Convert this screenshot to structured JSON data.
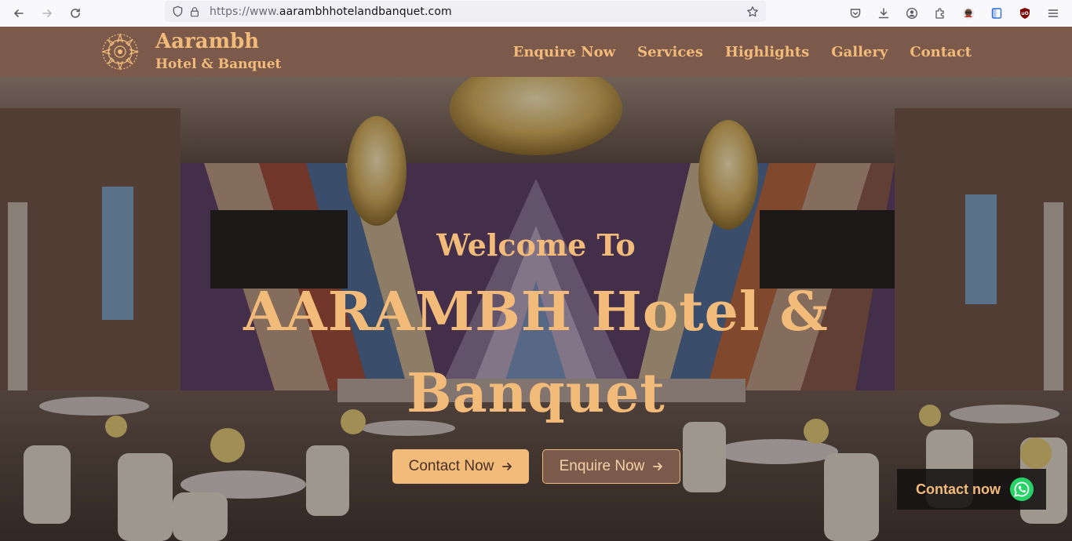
{
  "browser": {
    "url_protocol": "https://www.",
    "url_domain": "aarambhhotelandbanquet.com"
  },
  "header": {
    "brand_name": "Aarambh",
    "brand_sub": "Hotel & Banquet",
    "nav": [
      "Enquire Now",
      "Services",
      "Highlights",
      "Gallery",
      "Contact"
    ]
  },
  "hero": {
    "welcome": "Welcome To",
    "title": "AARAMBH Hotel & Banquet",
    "cta_contact": "Contact Now",
    "cta_enquire": "Enquire Now"
  },
  "floating": {
    "label": "Contact now"
  },
  "colors": {
    "accent": "#f3bb7a",
    "brand_brown": "#7b5a4b"
  }
}
